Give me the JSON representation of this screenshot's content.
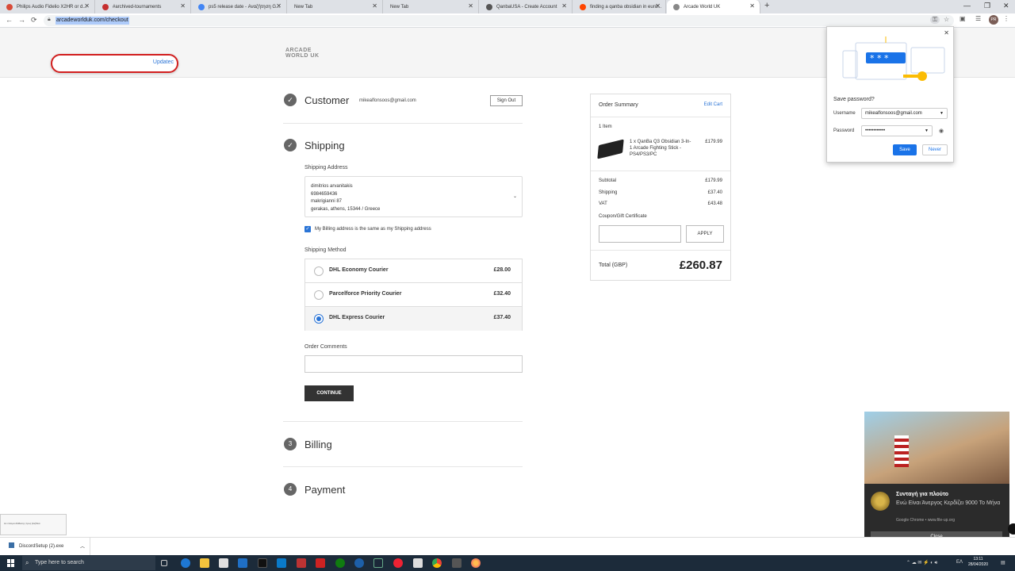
{
  "browser": {
    "tabs": [
      {
        "label": "Philips Audio Fidelio X2HR or d...",
        "color": "#d84a38"
      },
      {
        "label": "#archived-tournaments",
        "color": "#c62f2f"
      },
      {
        "label": "ps5 release date - Αναζήτηση G...",
        "color": "#4285f4"
      },
      {
        "label": "New Tab",
        "color": "#dee1e6"
      },
      {
        "label": "New Tab",
        "color": "#dee1e6"
      },
      {
        "label": "QanbaUSA - Create Account",
        "color": "#555555"
      },
      {
        "label": "finding a qanba obsidian in euro...",
        "color": "#ff4500"
      },
      {
        "label": "Arcade World UK",
        "color": "#888888"
      }
    ],
    "new_tab": "+",
    "url": "arcadeworlduk.com/checkout",
    "avatar": "PR"
  },
  "site": {
    "search_value": "Updatec",
    "logo_line1": "ARCADE",
    "logo_line2": "WORLD UK"
  },
  "checkout": {
    "customer": {
      "title": "Customer",
      "email": "mikealfonsoos@gmail.com",
      "signout": "Sign Out"
    },
    "shipping": {
      "title": "Shipping",
      "address_label": "Shipping Address",
      "address_lines": [
        "dimitrios arvanitakis",
        "6984659436",
        "makrigianni 87",
        "gerakas, athens, 15344 / Greece"
      ],
      "billing_same": "My Billing address is the same as my Shipping address",
      "method_label": "Shipping Method",
      "methods": [
        {
          "name": "DHL Economy Courier",
          "price": "£28.00"
        },
        {
          "name": "Parcelforce Priority Courier",
          "price": "£32.40"
        },
        {
          "name": "DHL Express Courier",
          "price": "£37.40"
        }
      ],
      "comments_label": "Order Comments",
      "continue": "CONTINUE"
    },
    "billing": {
      "step": "3",
      "title": "Billing"
    },
    "payment": {
      "step": "4",
      "title": "Payment"
    }
  },
  "summary": {
    "title": "Order Summary",
    "edit": "Edit Cart",
    "count": "1 Item",
    "item_name": "1 x QanBa Q3 Obsidian 3-In-1 Arcade Fighting Stick - PS4/PS3/PC",
    "item_price": "£179.99",
    "subtotal_label": "Subtotal",
    "subtotal": "£179.99",
    "shipping_label": "Shipping",
    "shipping": "£37.40",
    "vat_label": "VAT",
    "vat": "£43.48",
    "coupon_label": "Coupon/Gift Certificate",
    "apply": "APPLY",
    "total_label": "Total (GBP)",
    "total": "£260.87"
  },
  "password_popup": {
    "title": "Save password?",
    "username_label": "Username",
    "username": "mikealfonsoos@gmail.com",
    "password_label": "Password",
    "password": "••••••••••••",
    "save": "Save",
    "never": "Never"
  },
  "notification": {
    "title": "Συνταγή για πλούτο",
    "body": "Ενώ Είναι Άνεργος Κερδίζει 9000 Το Μήνα",
    "source": "Google Chrome • www.file-up.org",
    "close": "Close"
  },
  "left_doc": "Αν ντίσιμα διάθεσης προς βοήθεια",
  "download": {
    "file": "DiscordSetup (2).exe"
  },
  "taskbar": {
    "search_placeholder": "Type here to search",
    "lang": "ΕΛ",
    "time": "13:11",
    "date": "28/04/2020"
  }
}
